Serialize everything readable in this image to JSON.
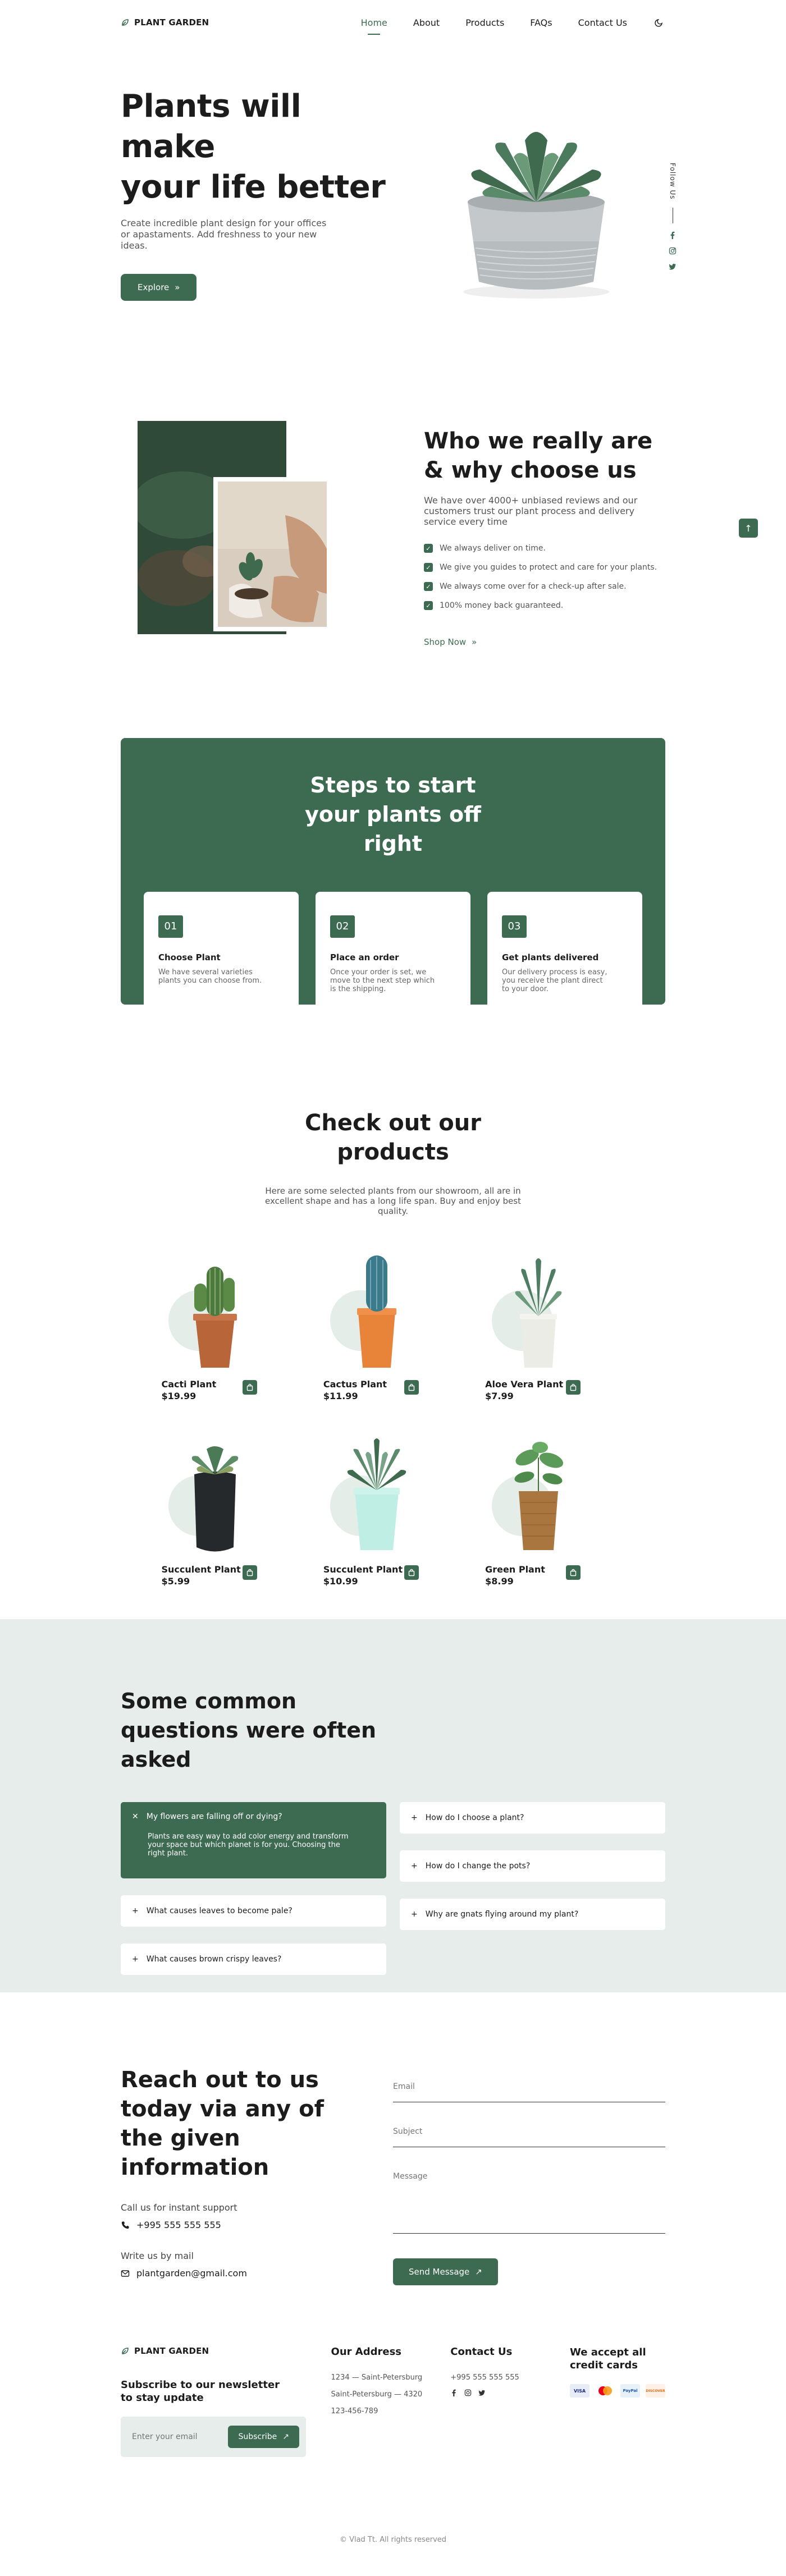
{
  "brand": {
    "name": "PLANT GARDEN"
  },
  "nav": {
    "items": [
      {
        "label": "Home",
        "active": true
      },
      {
        "label": "About",
        "active": false
      },
      {
        "label": "Products",
        "active": false
      },
      {
        "label": "FAQs",
        "active": false
      },
      {
        "label": "Contact Us",
        "active": false
      }
    ],
    "theme_icon": "moon-icon"
  },
  "hero": {
    "title_line1": "Plants will make",
    "title_line2": "your life better",
    "description": "Create incredible plant design for your offices or apastaments. Add freshness to your new ideas.",
    "button_label": "Explore",
    "follow_label": "Follow Us"
  },
  "about": {
    "title": "Who we really are & why choose us",
    "description": "We have over 4000+ unbiased reviews and our customers trust our plant process and delivery service every time",
    "checklist": [
      "We always deliver on time.",
      "We give you guides to protect and care for your plants.",
      "We always come over for a check-up after sale.",
      "100% money back guaranteed."
    ],
    "link_label": "Shop Now"
  },
  "steps": {
    "title": "Steps to start your plants off right",
    "items": [
      {
        "num": "01",
        "title": "Choose Plant",
        "desc": "We have several varieties plants you can choose from."
      },
      {
        "num": "02",
        "title": "Place an order",
        "desc": "Once your order is set, we move to the next step which is the shipping."
      },
      {
        "num": "03",
        "title": "Get plants delivered",
        "desc": "Our delivery process is easy, you receive the plant direct to your door."
      }
    ]
  },
  "products": {
    "title": "Check out our products",
    "description": "Here are some selected plants from our showroom, all are in excellent shape and has a long life span. Buy and enjoy best quality.",
    "items": [
      {
        "name": "Cacti Plant",
        "price": "$19.99"
      },
      {
        "name": "Cactus Plant",
        "price": "$11.99"
      },
      {
        "name": "Aloe Vera Plant",
        "price": "$7.99"
      },
      {
        "name": "Succulent Plant",
        "price": "$5.99"
      },
      {
        "name": "Succulent Plant",
        "price": "$10.99"
      },
      {
        "name": "Green Plant",
        "price": "$8.99"
      }
    ]
  },
  "faq": {
    "title": "Some common questions were often asked",
    "left": [
      {
        "q": "My flowers are falling off or dying?",
        "a": "Plants are easy way to add color energy and transform your space but which planet is for you. Choosing the right plant.",
        "open": true
      },
      {
        "q": "What causes leaves to become pale?"
      },
      {
        "q": "What causes brown crispy leaves?"
      }
    ],
    "right": [
      {
        "q": "How do I choose a plant?"
      },
      {
        "q": "How do I change the pots?"
      },
      {
        "q": "Why are gnats flying around my plant?"
      }
    ]
  },
  "contact": {
    "title": "Reach out to us today via any of the given information",
    "call_label": "Call us for instant support",
    "phone": "+995 555 555 555",
    "write_label": "Write us by mail",
    "email": "plantgarden@gmail.com",
    "form": {
      "email_placeholder": "Email",
      "subject_placeholder": "Subject",
      "message_placeholder": "Message",
      "button_label": "Send Message"
    }
  },
  "footer": {
    "newsletter_title": "Subscribe to our newsletter to stay update",
    "newsletter_placeholder": "Enter your email",
    "subscribe_label": "Subscribe",
    "address_title": "Our Address",
    "address_lines": [
      "1234 — Saint-Petersburg",
      "Saint-Petersburg — 4320",
      "123-456-789"
    ],
    "contact_title": "Contact Us",
    "contact_phone": "+995 555 555 555",
    "pay_title": "We accept all credit cards",
    "cards": [
      "VISA",
      "Mastercard",
      "PayPal",
      "DISCOVER"
    ],
    "copyright": "© Vlad Tt. All rights reserved"
  },
  "colors": {
    "accent": "#3d6b52",
    "faq_bg": "#e6edea"
  }
}
